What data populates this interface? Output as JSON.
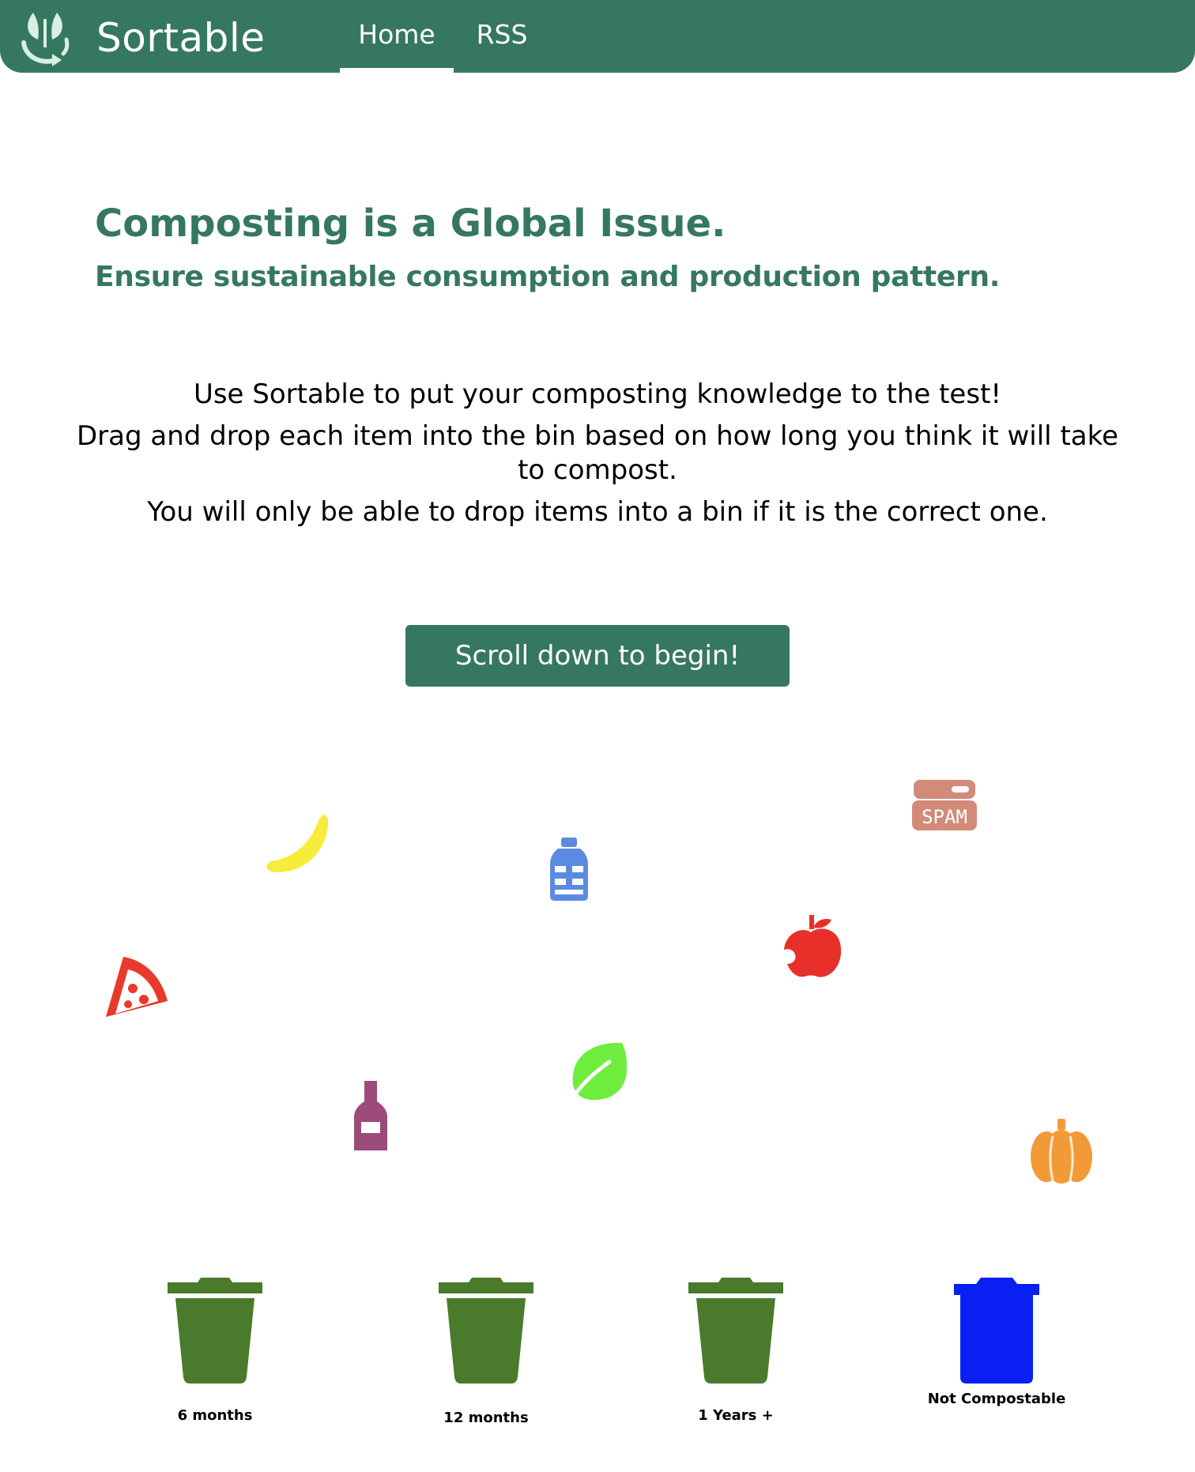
{
  "navbar": {
    "brand": "Sortable",
    "logo_icon": "recycle-leaf-icon",
    "links": [
      "Home",
      "RSS"
    ],
    "active_link": "Home",
    "background": "#367760"
  },
  "hero": {
    "title": "Composting is a Global Issue.",
    "subtitle": "Ensure sustainable consumption and production pattern."
  },
  "intro": {
    "line1": "Use Sortable to put your composting knowledge to the test!",
    "line2": "Drag and drop each item into the bin based on how long you think it will take to compost.",
    "line3": "You will only be able to drop items into a bin if it is the correct one."
  },
  "cta": {
    "label": "Scroll down to begin!"
  },
  "items": [
    {
      "name": "banana",
      "icon": "banana-icon",
      "color": "#f7ec3b"
    },
    {
      "name": "bottle",
      "icon": "bottle-icon",
      "color": "#5b8be0"
    },
    {
      "name": "spam",
      "icon": "spam-can-icon",
      "color": "#d28a79",
      "text": "SPAM"
    },
    {
      "name": "pizza",
      "icon": "pizza-slice-icon",
      "color": "#e83a2c"
    },
    {
      "name": "apple",
      "icon": "apple-icon",
      "color": "#e8302a"
    },
    {
      "name": "wine",
      "icon": "wine-bottle-icon",
      "color": "#9c4b7a"
    },
    {
      "name": "leaf",
      "icon": "leaf-icon",
      "color": "#6fed3f"
    },
    {
      "name": "pumpkin",
      "icon": "pumpkin-icon",
      "color": "#f29a38"
    }
  ],
  "bins": [
    {
      "label": "6  months",
      "icon": "trash-bin-icon",
      "color": "#4a7a2b"
    },
    {
      "label": "12 months",
      "icon": "trash-bin-icon",
      "color": "#4a7a2b"
    },
    {
      "label": "1 Years +",
      "icon": "trash-bin-icon",
      "color": "#4a7a2b"
    },
    {
      "label": "Not Compostable",
      "icon": "trash-bin-icon",
      "color": "#0a1ff2"
    }
  ]
}
